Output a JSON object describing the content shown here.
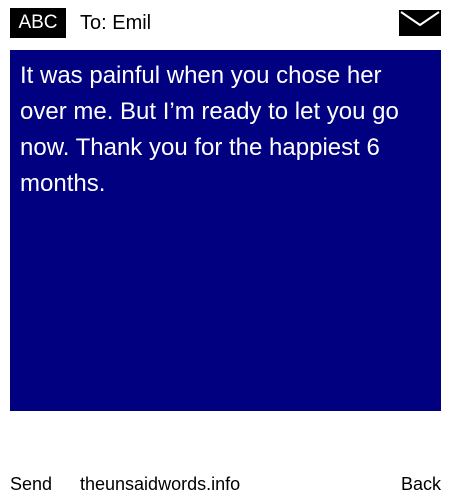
{
  "header": {
    "input_mode": "ABC",
    "recipient": "To: Emil",
    "icon": "envelope-icon"
  },
  "message": {
    "body": "It was painful when you chose her over me. But I’m ready to let you go now. Thank you for the happiest 6 months.",
    "background_color": "#000080",
    "text_color": "#ffffff"
  },
  "softkeys": {
    "left": "Send",
    "center": "theunsaidwords.info",
    "right": "Back"
  }
}
